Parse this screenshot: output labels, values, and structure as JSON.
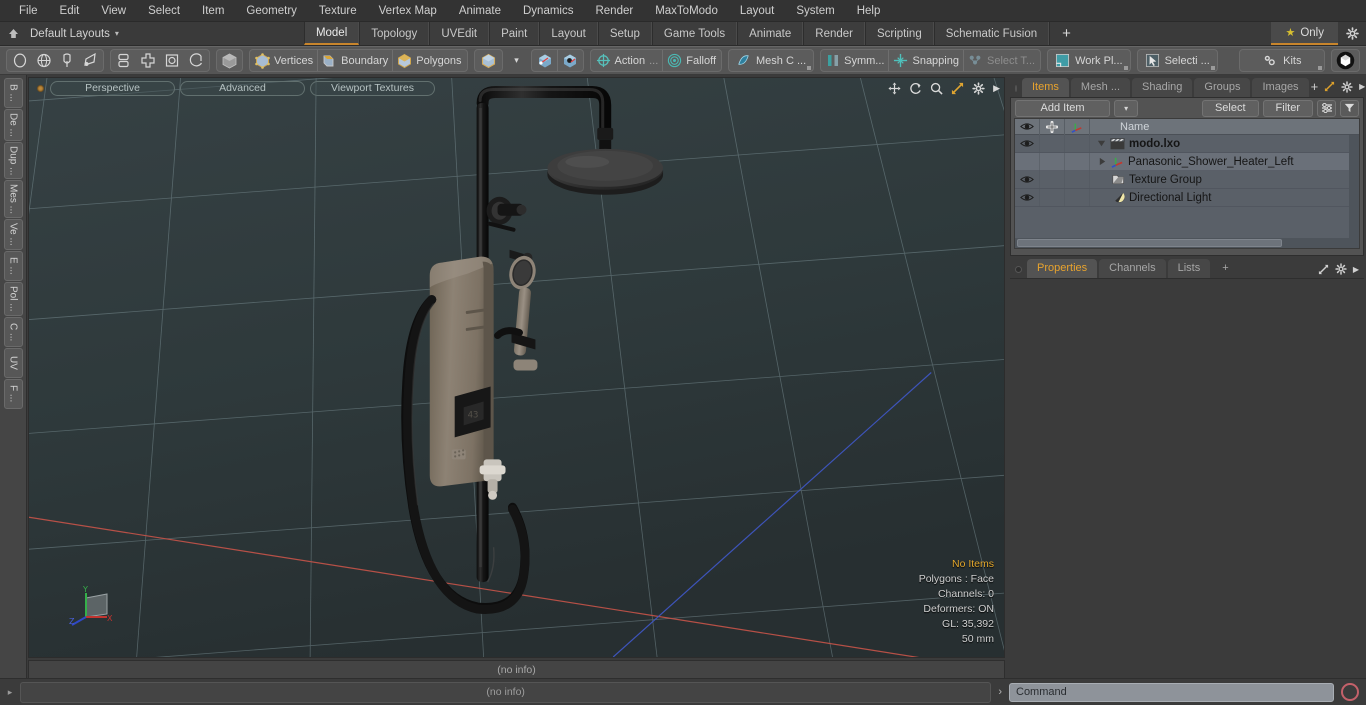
{
  "menubar": {
    "items": [
      {
        "label": "File"
      },
      {
        "label": "Edit"
      },
      {
        "label": "View"
      },
      {
        "label": "Select"
      },
      {
        "label": "Item"
      },
      {
        "label": "Geometry"
      },
      {
        "label": "Texture"
      },
      {
        "label": "Vertex Map"
      },
      {
        "label": "Animate"
      },
      {
        "label": "Dynamics"
      },
      {
        "label": "Render"
      },
      {
        "label": "MaxToModo"
      },
      {
        "label": "Layout"
      },
      {
        "label": "System"
      },
      {
        "label": "Help"
      }
    ]
  },
  "layoutbar": {
    "home_icon": "home-icon",
    "layouts_label": "Default Layouts",
    "caret": "▾",
    "tabs": [
      {
        "label": "Model",
        "active": true
      },
      {
        "label": "Topology",
        "active": false
      },
      {
        "label": "UVEdit",
        "active": false
      },
      {
        "label": "Paint",
        "active": false
      },
      {
        "label": "Layout",
        "active": false
      },
      {
        "label": "Setup",
        "active": false
      },
      {
        "label": "Game Tools",
        "active": false
      },
      {
        "label": "Animate",
        "active": false
      },
      {
        "label": "Render",
        "active": false
      },
      {
        "label": "Scripting",
        "active": false
      },
      {
        "label": "Schematic Fusion",
        "active": false
      }
    ],
    "plus_label": "+",
    "only_label": "Only",
    "only_star": "★",
    "gear_icon": "gear-icon",
    "active_accent": "#c8852c"
  },
  "toolbar": {
    "group_primitives": [
      {
        "name": "sphere-tool-icon"
      },
      {
        "name": "globe-tool-icon"
      },
      {
        "name": "pen-tool-icon"
      },
      {
        "name": "curve-tool-icon"
      }
    ],
    "group_ops": [
      {
        "name": "array-tool-icon"
      },
      {
        "name": "mirror-tool-icon"
      },
      {
        "name": "bevel-tool-icon"
      },
      {
        "name": "loop-tool-icon"
      }
    ],
    "item_mode_icon": "item-mode-icon",
    "selection_modes": [
      {
        "label": "Vertices",
        "icon": "vertices-icon"
      },
      {
        "label": "Boundary",
        "icon": "boundary-icon"
      },
      {
        "label": "Polygons",
        "icon": "polygons-icon"
      }
    ],
    "cube_button_icon": "cube-icon",
    "cube_caret": "▾",
    "axis_icons": [
      {
        "name": "center-axis-icon"
      },
      {
        "name": "pivot-axis-icon"
      }
    ],
    "action_label": "Action",
    "action_ellipsis": "...",
    "action_icon": "action-center-icon",
    "falloff_label": "Falloff",
    "falloff_icon": "falloff-icon",
    "mesh_constraint_label": "Mesh C ...",
    "mesh_constraint_icon": "mesh-constraint-icon",
    "symmetry_label": "Symm...",
    "symmetry_icon": "symmetry-icon",
    "snapping_label": "Snapping",
    "snapping_icon": "snapping-icon",
    "select_through_label": "Select T...",
    "select_through_icon": "select-through-icon",
    "work_plane_label": "Work Pl...",
    "work_plane_icon": "work-plane-icon",
    "selection_label": "Selecti ...",
    "selection_icon": "selection-icon",
    "kits_label": "Kits",
    "kits_icon": "kits-gear-icon",
    "modo_badge_icon": "modo-logo-icon",
    "unreal_badge_icon": "unreal-logo-icon"
  },
  "left_tabs": [
    {
      "label": "B ..."
    },
    {
      "label": "De ..."
    },
    {
      "label": "Dup ..."
    },
    {
      "label": "Mes ..."
    },
    {
      "label": "Ve ..."
    },
    {
      "label": "E ..."
    },
    {
      "label": "Pol ..."
    },
    {
      "label": "C ..."
    },
    {
      "label": "UV"
    },
    {
      "label": "F ..."
    }
  ],
  "viewport": {
    "pills": [
      {
        "label": "Perspective"
      },
      {
        "label": "Advanced"
      },
      {
        "label": "Viewport Textures"
      }
    ],
    "icons": [
      {
        "name": "pan-icon",
        "glyph": "✥"
      },
      {
        "name": "rotate-icon",
        "glyph": "↻"
      },
      {
        "name": "zoom-icon",
        "glyph": "⚲"
      },
      {
        "name": "fit-icon",
        "glyph": "⤡"
      },
      {
        "name": "viewport-settings-gear-icon",
        "glyph": "⚙"
      },
      {
        "name": "viewport-more-icon",
        "glyph": "▶"
      }
    ],
    "background_color": "#2f3a3c",
    "grid_color": "#8d9ea2",
    "axis_x_color": "#c4584d",
    "axis_z_color": "#3a58c8",
    "stats": {
      "selection": "No Items",
      "polygons": "Polygons : Face",
      "channels": "Channels: 0",
      "deformers": "Deformers: ON",
      "gl": "GL: 35,392",
      "unit": "50 mm"
    },
    "gizmo": {
      "x": "X",
      "y": "Y",
      "z": "Z"
    },
    "model_name": "Panasonic Shower Heater"
  },
  "infobar": {
    "text": "(no info)"
  },
  "right_panel": {
    "tabs": [
      {
        "label": "Items",
        "active": true
      },
      {
        "label": "Mesh ...",
        "active": false
      },
      {
        "label": "Shading",
        "active": false
      },
      {
        "label": "Groups",
        "active": false
      },
      {
        "label": "Images",
        "active": false
      }
    ],
    "tab_plus": "+",
    "tab_icons": [
      {
        "name": "popout-icon",
        "glyph": "⤡"
      },
      {
        "name": "panel-gear-icon",
        "glyph": "⚙"
      },
      {
        "name": "panel-more-icon",
        "glyph": "▶"
      }
    ],
    "add_item_label": "Add Item",
    "add_item_caret": "▾",
    "select_label": "Select",
    "filter_label": "Filter",
    "filter_list_icon": "filter-list-icon",
    "filter_funnel_icon": "filter-funnel-icon",
    "list_headers": {
      "eye": "visibility-column",
      "lock": "lock-column",
      "axis": "transform-column",
      "name": "Name"
    },
    "items": [
      {
        "label": "modo.lxo",
        "icon": "scene-clapper-icon",
        "indent": 0,
        "bold": true,
        "eye": true,
        "expanded": true,
        "selected": false
      },
      {
        "label": "Panasonic_Shower_Heater_Left",
        "icon": "mesh-axis-icon",
        "indent": 1,
        "bold": false,
        "eye": false,
        "expanded": false,
        "selected": true
      },
      {
        "label": "Texture Group",
        "icon": "texture-group-icon",
        "indent": 1,
        "bold": false,
        "eye": true,
        "expanded": false,
        "selected": false
      },
      {
        "label": "Directional Light",
        "icon": "directional-light-icon",
        "indent": 1,
        "bold": false,
        "eye": true,
        "expanded": false,
        "selected": false
      }
    ],
    "props_tabs": [
      {
        "label": "Properties",
        "active": true
      },
      {
        "label": "Channels",
        "active": false
      },
      {
        "label": "Lists",
        "active": false
      }
    ],
    "props_plus": "+",
    "accent": "#e8a32e"
  },
  "bottombar": {
    "left_arrow": "▸",
    "info_text": "(no info)",
    "prompt": "›",
    "command_value": "Command",
    "record_icon": "record-icon"
  }
}
